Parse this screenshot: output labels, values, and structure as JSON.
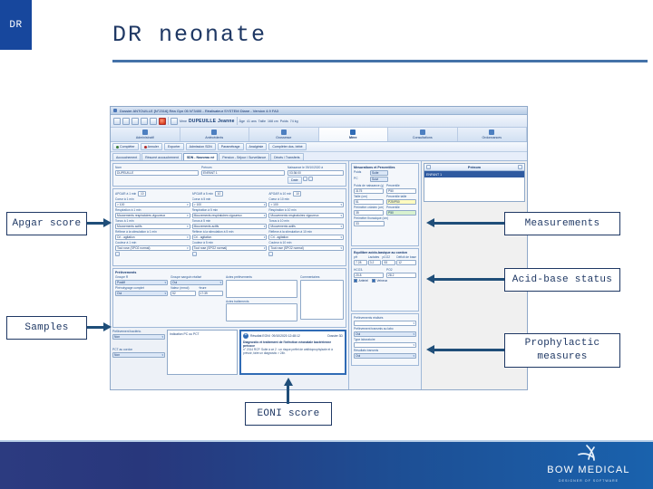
{
  "slide": {
    "header_tab": "DR",
    "title": "DR neonate"
  },
  "callouts": {
    "apgar": "Apgar score",
    "samples": "Samples",
    "eoni": "EONI score",
    "measurements": "Measurements",
    "acid_base": "Acid-base status",
    "prophylactic": "Prophylactic measures"
  },
  "screenshot": {
    "window_title": "Dossier ANTOUILLE [N°2316] Réa Gyn 05 N°3400 - Réalisateur SYSTEM Diane - Version 4.9 FA3",
    "patient": {
      "civility": "Mme",
      "name_label": "Nom",
      "name": "DUPEUILLE",
      "first_name_label": "Prénom",
      "first_name": "Jeanne",
      "age_label": "Âge",
      "age": "41 ans",
      "height_label": "Taille",
      "height": "168 cm",
      "weight_label": "Poids",
      "weight": "74 kg"
    },
    "toolbar_icons": [
      "save-icon",
      "open-icon",
      "print-icon",
      "print-preview-icon",
      "refresh-icon",
      "record-icon"
    ],
    "big_tabs": [
      {
        "label": "Administratif",
        "icon": "id-card-icon",
        "active": false
      },
      {
        "label": "Antécédents",
        "icon": "history-icon",
        "active": false
      },
      {
        "label": "Grossesse",
        "icon": "pregnancy-icon",
        "active": false
      },
      {
        "label": "Mère",
        "icon": "mother-icon",
        "active": true
      },
      {
        "label": "Consultations",
        "icon": "consult-icon",
        "active": false
      },
      {
        "label": "Ordonnances",
        "icon": "prescription-icon",
        "active": false
      }
    ],
    "strip_buttons": [
      "Compléter",
      "Annuler",
      "Exporter",
      "Admission SDN",
      "Paramétrage",
      "Analgésie",
      "Compléter dos. bébé"
    ],
    "sub_tabs": [
      {
        "label": "Accouchement",
        "active": false
      },
      {
        "label": "Résumé accouchement",
        "active": false
      },
      {
        "label": "SDN - Nouveau né",
        "active": true
      },
      {
        "label": "Pension - Séjour / Surveillance",
        "active": false
      },
      {
        "label": "Décès / Transferts",
        "active": false
      }
    ],
    "top_form": {
      "nom_label": "Nom",
      "nom_value": "DUPEUILLE",
      "prenom_label": "Prénom",
      "prenom_value": "ENFANT 1",
      "birth_label": "Naissance le 09/10/2020 à",
      "birth_time": "03:36:00",
      "birth_buttons": [
        "Date",
        "Modifier",
        "Supprimer"
      ]
    },
    "apgar_panel": {
      "title": "APGAR",
      "columns": [
        {
          "header": "APGAR à 1 min",
          "score": "10",
          "fields": [
            {
              "label": "Coeur à 1 min",
              "value": "> 100"
            },
            {
              "label": "Respiration à 1 min",
              "value": "Mouvements respiratoires vigoureux"
            },
            {
              "label": "Tonus à 1 min",
              "value": "Mouvements actifs"
            },
            {
              "label": "Réflexe à la stimulation à 1 min",
              "value": "Cri - agitation"
            },
            {
              "label": "Couleur à 1 min",
              "value": "Tout rose (SPO2 normal)"
            }
          ]
        },
        {
          "header": "APGAR à 5 min",
          "score": "10",
          "fields": [
            {
              "label": "Coeur à 5 min",
              "value": "> 100"
            },
            {
              "label": "Respiration à 5 min",
              "value": "Mouvements respiratoires vigoureux"
            },
            {
              "label": "Tonus à 5 min",
              "value": "Mouvements actifs"
            },
            {
              "label": "Réflexe à la stimulation à 5 min",
              "value": "Cri - agitation"
            },
            {
              "label": "Couleur à 5 min",
              "value": "Tout rose (SPO2 normal)"
            }
          ]
        },
        {
          "header": "APGAR à 10 min",
          "score": "10",
          "fields": [
            {
              "label": "Coeur à 10 min",
              "value": "> 100"
            },
            {
              "label": "Respiration à 10 min",
              "value": "Mouvements respiratoires vigoureux"
            },
            {
              "label": "Tonus à 10 min",
              "value": "Mouvements actifs"
            },
            {
              "label": "Réflexe à la stimulation à 10 min",
              "value": "Cri - agitation"
            },
            {
              "label": "Couleur à 10 min",
              "value": "Tout rose (SPO2 normal)"
            }
          ]
        }
      ]
    },
    "prelevements_panel": {
      "title": "Prélèvements",
      "fields": [
        {
          "label": "Groupe R",
          "value": "Positif"
        },
        {
          "label": "Phénotypage complet",
          "value": "Oui"
        },
        {
          "label": "Groupe sanguin réalisé",
          "value": "Oui"
        },
        {
          "label": "Valeur (mmol)",
          "value": "52"
        },
        {
          "label": "Heure",
          "value": "17:39"
        }
      ],
      "textareas": [
        {
          "label": "Actes prélèvements"
        },
        {
          "label": "Actes traitements"
        },
        {
          "label": "Commentaires"
        }
      ]
    },
    "mesurations_panel": {
      "title": "Mesurations et Percentiles",
      "toggle_rows": [
        {
          "label": "Poids",
          "button": "Suite"
        },
        {
          "label": "PC",
          "button": "Suivi"
        }
      ],
      "fields": [
        {
          "label": "Poids de naissance (g)",
          "value": "3175"
        },
        {
          "label": "Percentile",
          "value": "P50"
        },
        {
          "label": "Taille (cm)",
          "value": "51"
        },
        {
          "label": "Percentile taille",
          "value": "P25/P50",
          "style": "highlight"
        },
        {
          "label": "Périmètre crânien (cm)",
          "value": "35"
        },
        {
          "label": "Percentile",
          "value": "P50",
          "style": "green"
        },
        {
          "label": "Périmètre thoracique (cm)",
          "value": "33"
        }
      ]
    },
    "acid_base_panel": {
      "title": "Equilibre acido-basique au cordon",
      "headers": [
        "pH",
        "Lactates",
        "pCO2",
        "Déficit de base"
      ],
      "values": [
        "7.28",
        "3.2",
        "53",
        "12"
      ],
      "sub_fields": [
        {
          "label": "HCO3-",
          "value": "20.8"
        },
        {
          "label": "PO2",
          "value": "28.2"
        }
      ],
      "checkboxes": [
        "Artériel",
        "Veineux"
      ],
      "extra_fields": [
        {
          "label": "Prélèvements réalisés",
          "value": ""
        },
        {
          "label": "Prélèvement transmis au labo",
          "value": "Oui"
        },
        {
          "label": "Type laboratoire",
          "value": ""
        },
        {
          "label": "Résultats transmis",
          "value": "Oui"
        }
      ]
    },
    "eoni_panel": {
      "left_fields": [
        {
          "label": "Prélèvement bactério.",
          "value": "Non"
        },
        {
          "label": "PCT au cordon",
          "value": "Non"
        }
      ],
      "middle_label": "Indication PC ou PCT",
      "note_header": {
        "status": "Résultat EONI",
        "date": "09/10/2020 12:48:12",
        "author": "Dossier 3D"
      },
      "note_title": "Diagnostic et traitement de l'infection néonatale bactérienne précoce",
      "note_body": "n° 2014 RCP. Suite à ce 2 : un risque préfet de antibioprophylaxie et à prévoir, faire un diagnostic > 24h."
    }
  },
  "footer": {
    "logo_text": "BOW MEDICAL",
    "logo_tagline": "DESIGNER OF SOFTWARE"
  },
  "colors": {
    "brand_blue": "#17479d",
    "title_navy": "#1f3864",
    "arrow_blue": "#1f4e79",
    "rule_blue": "#4472a8"
  }
}
